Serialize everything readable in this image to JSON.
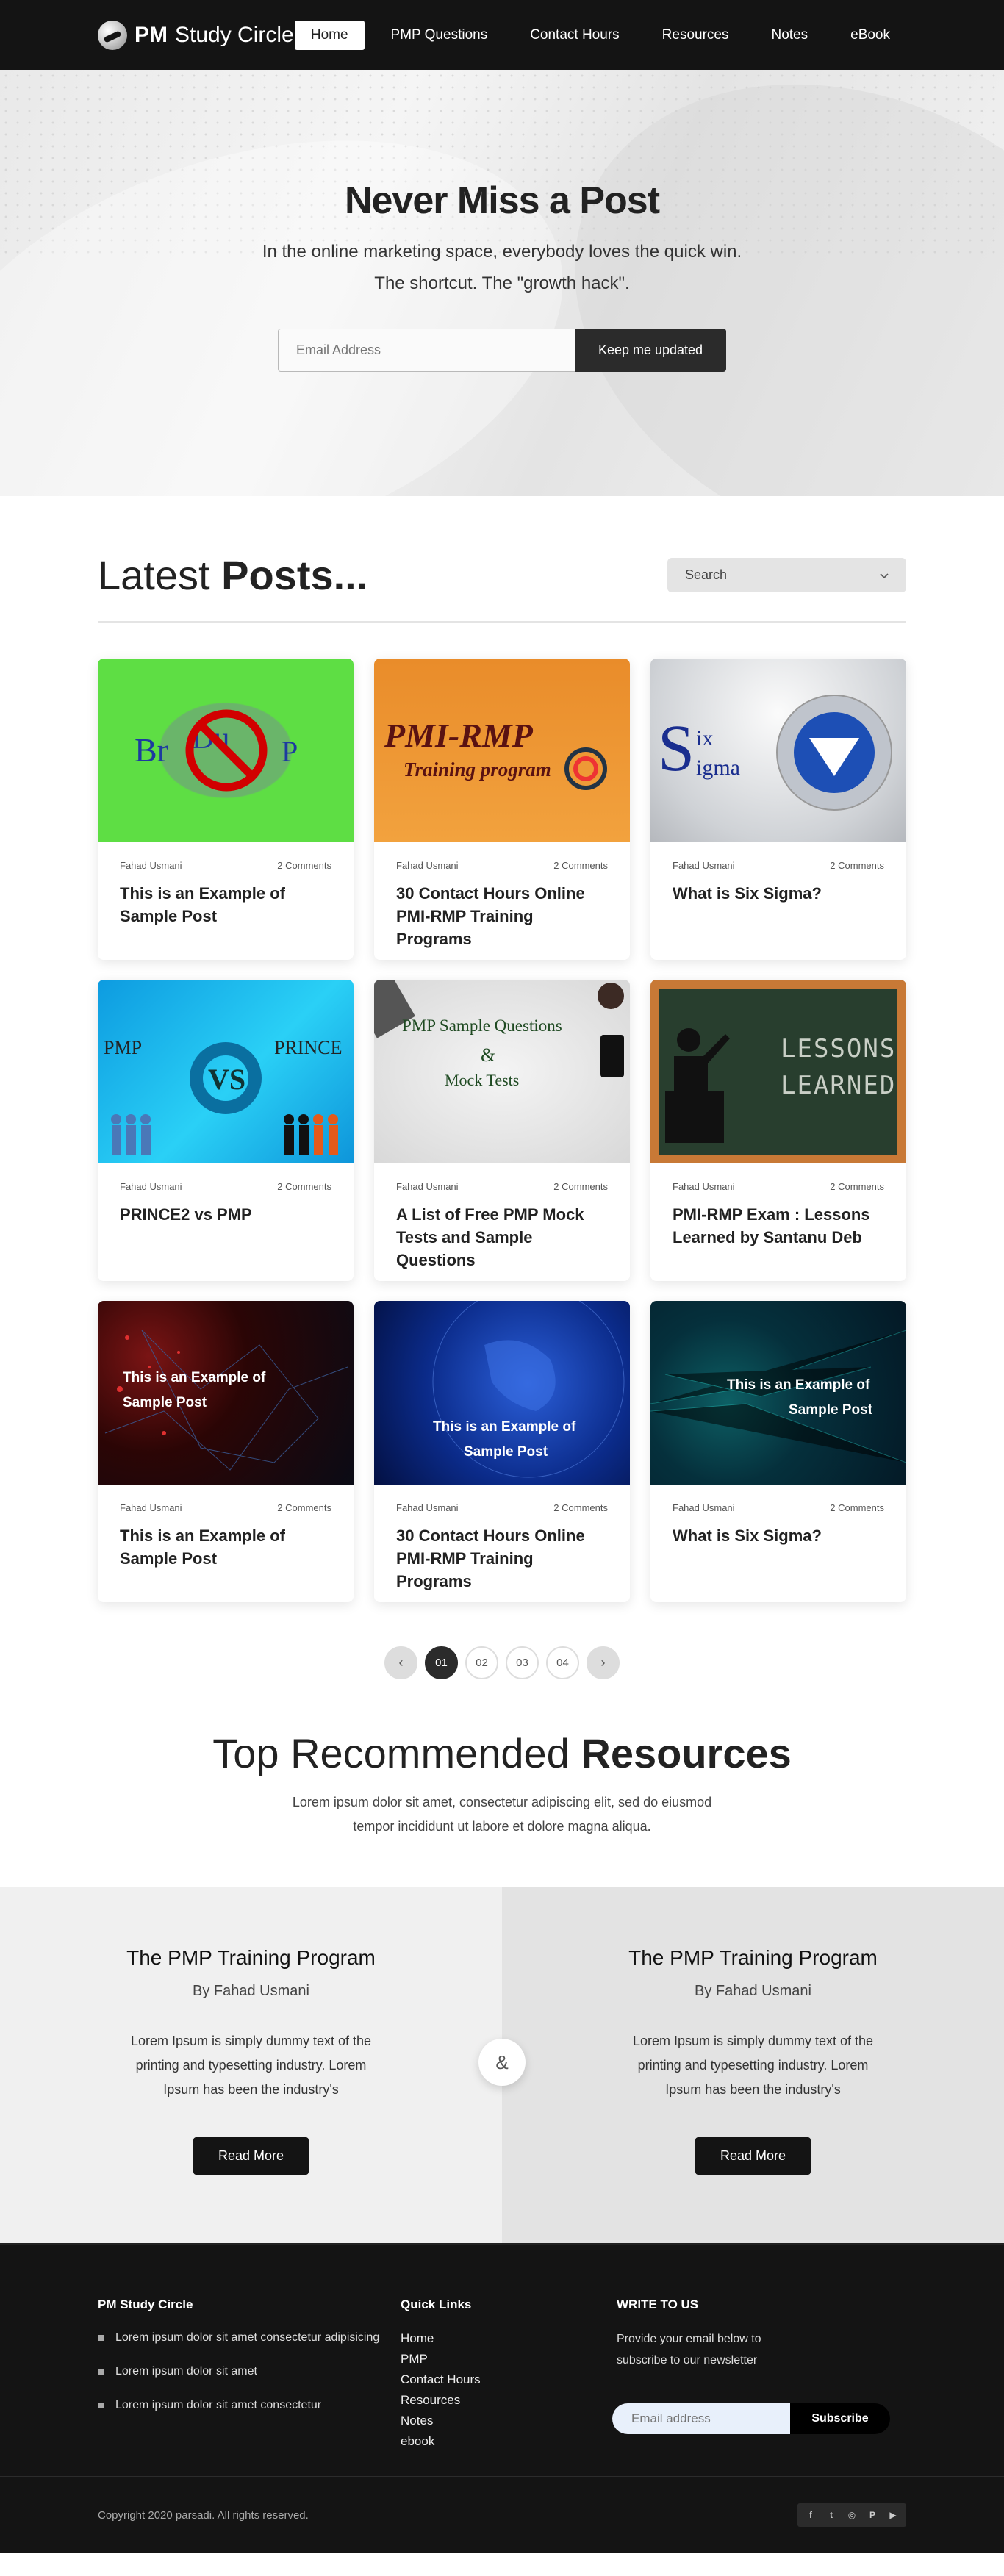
{
  "header": {
    "brand": "PM",
    "brand_rest": "Study Circle",
    "nav": [
      {
        "label": "Home",
        "active": true
      },
      {
        "label": "PMP Questions"
      },
      {
        "label": "Contact Hours"
      },
      {
        "label": "Resources"
      },
      {
        "label": "Notes"
      },
      {
        "label": "eBook"
      }
    ]
  },
  "hero": {
    "title": "Never Miss a Post",
    "line1": "In the online marketing space, everybody loves the quick win.",
    "line2": "The shortcut. The \"growth hack\".",
    "email_placeholder": "Email Address",
    "button": "Keep me updated"
  },
  "latest": {
    "heading_light": "Latest",
    "heading_bold": "Posts...",
    "search_label": "Search",
    "posts": [
      {
        "author": "Fahad Usmani",
        "comments": "2 Comments",
        "title": "This is an Example of Sample Post",
        "thumb": "brain-dump"
      },
      {
        "author": "Fahad Usmani",
        "comments": "2 Comments",
        "title": "30 Contact Hours Online PMI-RMP Training Programs",
        "thumb": "pmi-rmp",
        "thumb_text1": "PMI-RMP",
        "thumb_text2": "Training program"
      },
      {
        "author": "Fahad Usmani",
        "comments": "2 Comments",
        "title": "What is Six Sigma?",
        "thumb": "six-sigma",
        "thumb_text1": "ix",
        "thumb_text2": "igma"
      },
      {
        "author": "Fahad Usmani",
        "comments": "2 Comments",
        "title": "PRINCE2 vs PMP",
        "thumb": "prince-vs-pmp",
        "thumb_text1": "PMP",
        "thumb_text2": "PRINCE",
        "thumb_text3": "VS"
      },
      {
        "author": "Fahad Usmani",
        "comments": "2 Comments",
        "title": "A List of Free PMP Mock Tests and Sample Questions",
        "thumb": "mock-tests",
        "thumb_text1": "PMP Sample Questions",
        "thumb_text2": "&",
        "thumb_text3": "Mock Tests"
      },
      {
        "author": "Fahad Usmani",
        "comments": "2 Comments",
        "title": "PMI-RMP Exam : Lessons Learned by Santanu Deb",
        "thumb": "lessons-learned",
        "thumb_text1": "LESSONS",
        "thumb_text2": "LEARNED"
      },
      {
        "author": "Fahad Usmani",
        "comments": "2 Comments",
        "title": "This is an Example of Sample Post",
        "thumb": "network-red",
        "overlay1": "This is an Example of",
        "overlay2": "Sample Post"
      },
      {
        "author": "Fahad Usmani",
        "comments": "2 Comments",
        "title": "30 Contact Hours Online PMI-RMP Training Programs",
        "thumb": "globe",
        "overlay1": "This is an Example of",
        "overlay2": "Sample Post"
      },
      {
        "author": "Fahad Usmani",
        "comments": "2 Comments",
        "title": "What is Six Sigma?",
        "thumb": "network-teal",
        "overlay1": "This is an Example of",
        "overlay2": "Sample Post"
      }
    ]
  },
  "pagination": {
    "prev": "‹",
    "pages": [
      "01",
      "02",
      "03",
      "04"
    ],
    "current": "01",
    "next": "›"
  },
  "recommended": {
    "heading_light": "Top Recommended",
    "heading_bold": "Resources",
    "line1": "Lorem ipsum dolor sit amet, consectetur adipiscing elit, sed do eiusmod",
    "line2": "tempor incididunt ut labore et dolore magna aliqua.",
    "ampersand": "&",
    "items": [
      {
        "title": "The PMP Training Program",
        "by": "By Fahad Usmani",
        "desc1": "Lorem Ipsum is simply dummy text of the",
        "desc2": "printing and typesetting industry. Lorem",
        "desc3": "Ipsum has been the industry's",
        "button": "Read More"
      },
      {
        "title": "The PMP Training Program",
        "by": "By Fahad Usmani",
        "desc1": "Lorem Ipsum is simply dummy text of the",
        "desc2": "printing and typesetting industry. Lorem",
        "desc3": "Ipsum has been the industry's",
        "button": "Read More"
      }
    ]
  },
  "footer": {
    "col1_title": "PM Study Circle",
    "col1_items": [
      "Lorem ipsum dolor sit amet consectetur adipisicing",
      "Lorem ipsum dolor sit amet",
      "Lorem ipsum dolor sit amet consectetur"
    ],
    "col2_title": "Quick Links",
    "col2_links": [
      "Home",
      "PMP",
      "Contact Hours",
      "Resources",
      "Notes",
      "ebook"
    ],
    "col3_title": "WRITE TO US",
    "col3_text1": "Provide your email below to",
    "col3_text2": "subscribe to our newsletter",
    "email_placeholder": "Email address",
    "subscribe_button": "Subscribe",
    "copyright": "Copyright 2020 parsadi. All rights reserved.",
    "social": [
      {
        "icon": "facebook-icon",
        "glyph": "f"
      },
      {
        "icon": "twitter-icon",
        "glyph": "t"
      },
      {
        "icon": "instagram-icon",
        "glyph": "◎"
      },
      {
        "icon": "pinterest-icon",
        "glyph": "P"
      },
      {
        "icon": "youtube-icon",
        "glyph": "▶"
      }
    ]
  }
}
